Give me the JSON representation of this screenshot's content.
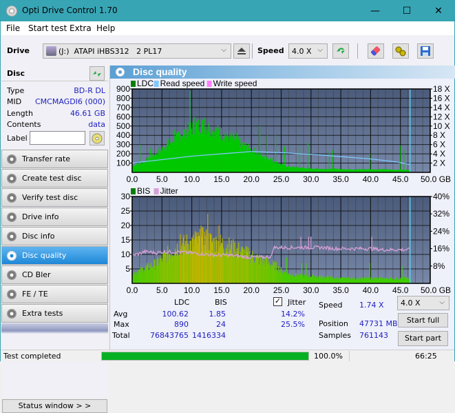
{
  "window": {
    "title": "Opti Drive Control 1.70",
    "minimize": "—",
    "maximize": "☐",
    "close": "✕"
  },
  "menu": [
    "File",
    "Start test",
    "Extra",
    "Help"
  ],
  "toolbar": {
    "drive_label": "Drive",
    "drive_value": "(J:)  ATAPI iHBS312   2 PL17",
    "speed_label": "Speed",
    "speed_value": "4.0 X"
  },
  "disc": {
    "header": "Disc",
    "rows": [
      {
        "key": "Type",
        "value": "BD-R DL"
      },
      {
        "key": "MID",
        "value": "CMCMAGDI6 (000)"
      },
      {
        "key": "Length",
        "value": "46.61 GB"
      },
      {
        "key": "Contents",
        "value": "data"
      }
    ],
    "label_key": "Label",
    "label_value": ""
  },
  "nav": [
    {
      "label": "Transfer rate",
      "active": false
    },
    {
      "label": "Create test disc",
      "active": false
    },
    {
      "label": "Verify test disc",
      "active": false
    },
    {
      "label": "Drive info",
      "active": false
    },
    {
      "label": "Disc info",
      "active": false
    },
    {
      "label": "Disc quality",
      "active": true
    },
    {
      "label": "CD Bler",
      "active": false
    },
    {
      "label": "FE / TE",
      "active": false
    },
    {
      "label": "Extra tests",
      "active": false
    }
  ],
  "status_window_label": "Status window > >",
  "panel_title": "Disc quality",
  "chart_data": [
    {
      "type": "bar",
      "title": "LDC / Read speed",
      "legend": [
        "LDC",
        "Read speed",
        "Write speed"
      ],
      "legend_colors": [
        "#008000",
        "#80c8ff",
        "#ff80ff"
      ],
      "xlabel": "GB",
      "x_ticks": [
        "0.0",
        "5.0",
        "10.0",
        "15.0",
        "20.0",
        "25.0",
        "30.0",
        "35.0",
        "40.0",
        "45.0",
        "50.0 GB"
      ],
      "y_ticks_left": [
        "100",
        "200",
        "300",
        "400",
        "500",
        "600",
        "700",
        "800",
        "900"
      ],
      "y_ticks_right": [
        "2 X",
        "4 X",
        "6 X",
        "8 X",
        "10 X",
        "12 X",
        "14 X",
        "16 X",
        "18 X"
      ],
      "xlim": [
        0,
        50
      ],
      "ylim_left": [
        0,
        900
      ],
      "ylim_right": [
        0,
        18
      ],
      "disc_end_gb": 46.61,
      "ldc_envelope": {
        "x": [
          0,
          1,
          2,
          3,
          4,
          5,
          6,
          7,
          8,
          9,
          10,
          11,
          12,
          13,
          14,
          15,
          16,
          17,
          18,
          19,
          20,
          21,
          22,
          23,
          24,
          25,
          26,
          27,
          28,
          29,
          30,
          32,
          34,
          36,
          38,
          40,
          42,
          44,
          46,
          46.6
        ],
        "y": [
          80,
          100,
          130,
          170,
          220,
          270,
          330,
          380,
          430,
          480,
          520,
          550,
          540,
          510,
          480,
          450,
          420,
          390,
          350,
          300,
          260,
          220,
          190,
          160,
          120,
          90,
          70,
          60,
          55,
          50,
          45,
          40,
          40,
          35,
          35,
          35,
          35,
          30,
          30,
          30
        ]
      },
      "ldc_spikes": [
        {
          "x": 1.2,
          "y": 300
        },
        {
          "x": 3.0,
          "y": 260
        },
        {
          "x": 4.5,
          "y": 300
        },
        {
          "x": 7.0,
          "y": 460
        },
        {
          "x": 9.6,
          "y": 880
        },
        {
          "x": 10.3,
          "y": 600
        },
        {
          "x": 12.0,
          "y": 590
        },
        {
          "x": 17.5,
          "y": 430
        },
        {
          "x": 21.3,
          "y": 500
        },
        {
          "x": 22.6,
          "y": 400
        },
        {
          "x": 24.0,
          "y": 400
        },
        {
          "x": 25.5,
          "y": 280
        },
        {
          "x": 28.0,
          "y": 280
        },
        {
          "x": 29.4,
          "y": 320
        },
        {
          "x": 33.0,
          "y": 220
        },
        {
          "x": 33.5,
          "y": 240
        },
        {
          "x": 39.8,
          "y": 200
        },
        {
          "x": 45.0,
          "y": 290
        },
        {
          "x": 45.5,
          "y": 250
        }
      ],
      "read_speed": {
        "x": [
          0,
          2,
          4,
          6,
          8,
          10,
          12,
          14,
          16,
          18,
          20,
          22,
          24,
          26,
          28,
          30,
          32,
          34,
          36,
          38,
          40,
          42,
          44,
          46.6
        ],
        "y": [
          2.0,
          2.3,
          2.6,
          2.9,
          3.2,
          3.5,
          3.7,
          3.9,
          4.1,
          4.3,
          4.5,
          4.4,
          4.3,
          4.2,
          4.0,
          3.9,
          3.7,
          3.5,
          3.3,
          3.1,
          2.9,
          2.6,
          2.3,
          1.74
        ]
      }
    },
    {
      "type": "bar",
      "title": "BIS / Jitter",
      "legend": [
        "BIS",
        "Jitter"
      ],
      "legend_colors": [
        "#008000",
        "#d8a0d8"
      ],
      "xlabel": "GB",
      "x_ticks": [
        "0.0",
        "5.0",
        "10.0",
        "15.0",
        "20.0",
        "25.0",
        "30.0",
        "35.0",
        "40.0",
        "45.0",
        "50.0 GB"
      ],
      "y_ticks_left": [
        "5",
        "10",
        "15",
        "20",
        "25",
        "30"
      ],
      "y_ticks_right": [
        "8%",
        "16%",
        "24%",
        "32%",
        "40%"
      ],
      "xlim": [
        0,
        50
      ],
      "ylim_left": [
        0,
        30
      ],
      "ylim_right": [
        0,
        40
      ],
      "disc_end_gb": 46.61,
      "bis_envelope": {
        "x": [
          0,
          1,
          2,
          3,
          4,
          5,
          6,
          7,
          8,
          9,
          10,
          11,
          12,
          13,
          14,
          15,
          16,
          17,
          18,
          19,
          20,
          21,
          22,
          23,
          24,
          25,
          26,
          28,
          30,
          35,
          40,
          45,
          46.6
        ],
        "y": [
          4,
          5,
          6,
          7,
          8,
          10,
          12,
          14,
          15,
          16,
          16,
          17,
          18,
          17,
          16,
          16,
          15,
          14,
          13,
          12,
          11,
          10,
          9,
          8,
          7,
          5,
          4,
          3,
          3,
          2,
          2,
          2,
          2
        ]
      },
      "bis_spikes": [
        {
          "x": 11.5,
          "y": 20
        },
        {
          "x": 12.6,
          "y": 24
        },
        {
          "x": 14.5,
          "y": 20
        },
        {
          "x": 10.5,
          "y": 18
        },
        {
          "x": 8.0,
          "y": 17
        },
        {
          "x": 25.8,
          "y": 9
        },
        {
          "x": 28.4,
          "y": 7
        },
        {
          "x": 29.1,
          "y": 7
        },
        {
          "x": 39.8,
          "y": 7
        },
        {
          "x": 45.2,
          "y": 6
        }
      ],
      "jitter": {
        "x": [
          0,
          1,
          2,
          3,
          4,
          5,
          6,
          8,
          10,
          12,
          14,
          16,
          18,
          20,
          22,
          23.5,
          23.6,
          25,
          27,
          29,
          30,
          32,
          34,
          36,
          38,
          40,
          42,
          44,
          46.6
        ],
        "y": [
          13.0,
          13.5,
          14.5,
          14.5,
          14.0,
          14.5,
          14.5,
          14.5,
          14.0,
          13.5,
          13.0,
          13.0,
          12.5,
          12.0,
          12.0,
          12.5,
          16.5,
          16.5,
          16.5,
          16.5,
          16.5,
          16.5,
          16.0,
          16.0,
          16.0,
          16.0,
          15.5,
          15.5,
          15.5
        ]
      },
      "jitter_spikes": [
        {
          "x": 28.3,
          "y": 21.5
        },
        {
          "x": 29.6,
          "y": 21.5
        },
        {
          "x": 30.0,
          "y": 21.5
        },
        {
          "x": 40.2,
          "y": 21.5
        }
      ]
    }
  ],
  "stats": {
    "col_ldc": "LDC",
    "col_bis": "BIS",
    "jitter_label": "Jitter",
    "jitter_checked": true,
    "avg_label": "Avg",
    "max_label": "Max",
    "total_label": "Total",
    "ldc_avg": "100.62",
    "ldc_max": "890",
    "ldc_total": "76843765",
    "bis_avg": "1.85",
    "bis_max": "24",
    "bis_total": "1416334",
    "jitter_avg": "14.2%",
    "jitter_max": "25.5%",
    "speed_label": "Speed",
    "speed_value": "1.74 X",
    "position_label": "Position",
    "position_value": "47731 MB",
    "samples_label": "Samples",
    "samples_value": "761143",
    "speed_select": "4.0 X",
    "start_full": "Start full",
    "start_part": "Start part"
  },
  "statusbar": {
    "text": "Test completed",
    "progress": 100.0,
    "progress_text": "100.0%",
    "time": "66:25"
  },
  "colors": {
    "titlebar": "#38a5b5",
    "ldc": "#00c800",
    "read_speed": "#80c8ff",
    "jitter": "#d8a0d8",
    "progress": "#06b025",
    "value_text": "#2020c0"
  }
}
